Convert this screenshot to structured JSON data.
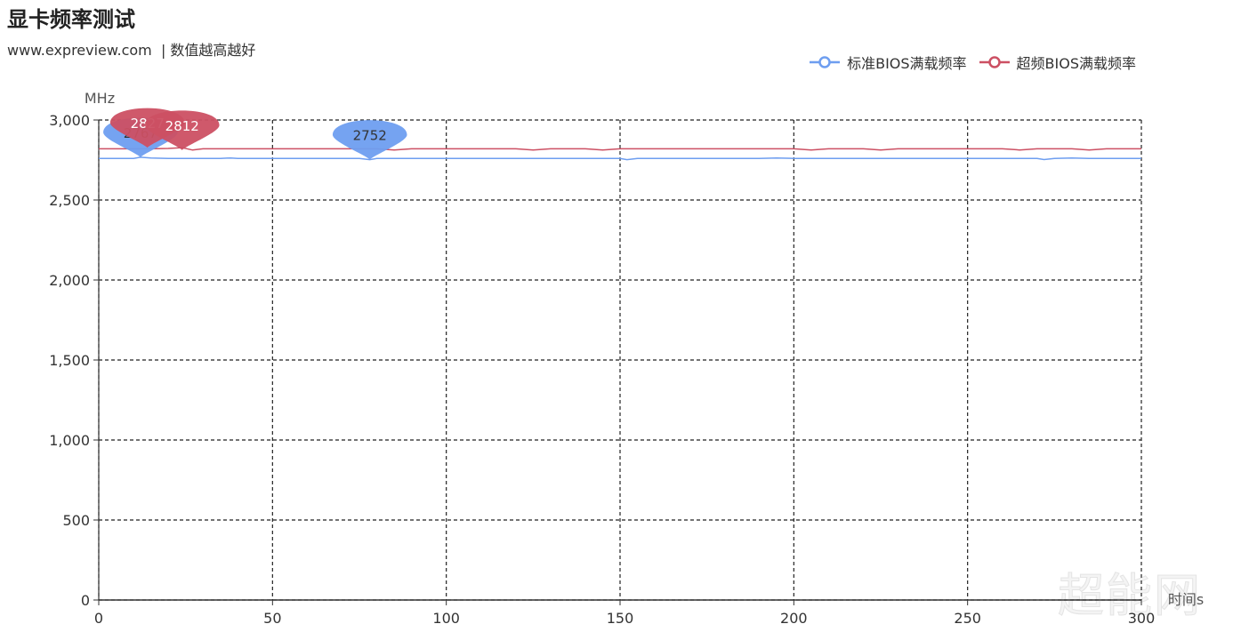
{
  "header": {
    "title": "显卡频率测试",
    "subtitle": "www.expreview.com  | 数值越高越好"
  },
  "watermark": "超能网",
  "legend": [
    {
      "name": "标准BIOS满载频率",
      "color": "#6e9ef0"
    },
    {
      "name": "超频BIOS满载频率",
      "color": "#cc5063"
    }
  ],
  "chart_data": {
    "type": "line",
    "title": "显卡频率测试",
    "subtitle": "www.expreview.com  | 数值越高越好",
    "xlabel": "时间s",
    "ylabel": "MHz",
    "xlim": [
      0,
      300
    ],
    "ylim": [
      0,
      3000
    ],
    "x_ticks": [
      0,
      50,
      100,
      150,
      200,
      250,
      300
    ],
    "y_ticks": [
      0,
      500,
      1000,
      1500,
      2000,
      2500,
      3000
    ],
    "y_tick_labels": [
      "0",
      "500",
      "1,000",
      "1,500",
      "2,000",
      "2,500",
      "3,000"
    ],
    "grid": "dashed",
    "legend_position": "top-right",
    "series": [
      {
        "name": "标准BIOS满载频率",
        "color": "#6e9ef0",
        "x": [
          0,
          5,
          10,
          12,
          15,
          20,
          25,
          30,
          35,
          38,
          40,
          45,
          50,
          55,
          60,
          65,
          70,
          75,
          78,
          80,
          85,
          90,
          95,
          100,
          105,
          110,
          115,
          120,
          125,
          130,
          135,
          140,
          145,
          150,
          152,
          155,
          160,
          165,
          170,
          175,
          180,
          185,
          190,
          195,
          200,
          205,
          210,
          215,
          220,
          225,
          230,
          235,
          240,
          245,
          250,
          255,
          260,
          265,
          270,
          272,
          275,
          280,
          285,
          290,
          295,
          300
        ],
        "y": [
          2760,
          2760,
          2760,
          2767,
          2762,
          2760,
          2760,
          2760,
          2760,
          2763,
          2760,
          2760,
          2760,
          2760,
          2760,
          2760,
          2760,
          2760,
          2752,
          2760,
          2760,
          2760,
          2760,
          2760,
          2760,
          2760,
          2760,
          2760,
          2760,
          2760,
          2760,
          2760,
          2760,
          2760,
          2752,
          2760,
          2760,
          2760,
          2760,
          2760,
          2760,
          2760,
          2760,
          2763,
          2760,
          2760,
          2760,
          2760,
          2760,
          2760,
          2760,
          2760,
          2760,
          2760,
          2760,
          2760,
          2760,
          2760,
          2760,
          2753,
          2760,
          2763,
          2760,
          2760,
          2760,
          2760
        ]
      },
      {
        "name": "超频BIOS满载频率",
        "color": "#cc5063",
        "x": [
          0,
          5,
          10,
          15,
          20,
          24,
          27,
          30,
          35,
          40,
          45,
          50,
          55,
          60,
          65,
          70,
          75,
          80,
          85,
          90,
          95,
          100,
          105,
          110,
          115,
          120,
          125,
          130,
          135,
          140,
          145,
          150,
          155,
          160,
          165,
          170,
          175,
          180,
          185,
          190,
          195,
          200,
          205,
          210,
          215,
          220,
          225,
          230,
          235,
          240,
          245,
          250,
          255,
          260,
          265,
          270,
          275,
          280,
          285,
          290,
          295,
          300
        ],
        "y": [
          2820,
          2820,
          2820,
          2820,
          2822,
          2827,
          2812,
          2820,
          2820,
          2820,
          2820,
          2820,
          2820,
          2820,
          2820,
          2820,
          2820,
          2820,
          2813,
          2820,
          2820,
          2820,
          2820,
          2820,
          2820,
          2820,
          2813,
          2820,
          2820,
          2820,
          2813,
          2820,
          2820,
          2820,
          2820,
          2820,
          2820,
          2820,
          2820,
          2820,
          2820,
          2820,
          2813,
          2820,
          2820,
          2820,
          2813,
          2820,
          2820,
          2820,
          2820,
          2820,
          2820,
          2820,
          2813,
          2820,
          2820,
          2820,
          2813,
          2820,
          2820,
          2820
        ]
      }
    ],
    "markers": [
      {
        "series": "标准BIOS满载频率",
        "label": "2767",
        "x": 12,
        "y": 2767,
        "type": "max"
      },
      {
        "series": "标准BIOS满载频率",
        "label": "2752",
        "x": 78,
        "y": 2752,
        "type": "min"
      },
      {
        "series": "超频BIOS满载频率",
        "label": "2827",
        "x": 14,
        "y": 2827,
        "type": "max"
      },
      {
        "series": "超频BIOS满载频率",
        "label": "2812",
        "x": 24,
        "y": 2812,
        "type": "min"
      }
    ]
  }
}
